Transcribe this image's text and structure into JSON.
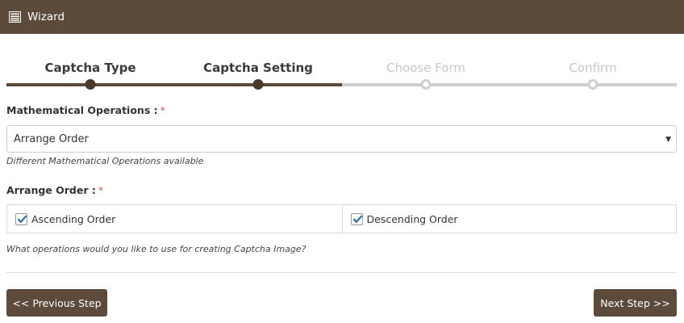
{
  "header": {
    "title": "Wizard",
    "icon": "list-icon"
  },
  "steps": [
    {
      "label": "Captcha Type",
      "state": "done"
    },
    {
      "label": "Captcha Setting",
      "state": "done"
    },
    {
      "label": "Choose Form",
      "state": "todo"
    },
    {
      "label": "Confirm",
      "state": "todo"
    }
  ],
  "math_ops": {
    "label": "Mathematical Operations :",
    "required_mark": "*",
    "selected": "Arrange Order",
    "help": "Different Mathematical Operations available"
  },
  "arrange_order": {
    "label": "Arrange Order :",
    "required_mark": "*",
    "options": [
      {
        "label": "Ascending Order",
        "checked": true
      },
      {
        "label": "Descending Order",
        "checked": true
      }
    ],
    "help": "What operations would you like to use for creating Captcha Image?"
  },
  "buttons": {
    "prev": "<< Previous Step",
    "next": "Next Step >>"
  },
  "colors": {
    "brand": "#5c4a3b",
    "required": "#d9534f",
    "check": "#2a6fb0"
  }
}
